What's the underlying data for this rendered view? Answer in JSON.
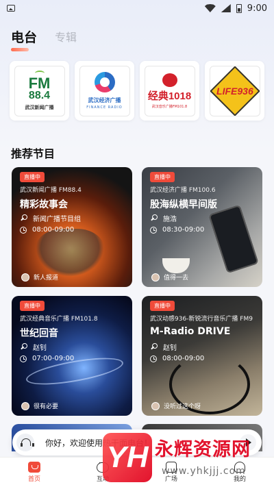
{
  "status_bar": {
    "time": "9:00"
  },
  "tabs": [
    {
      "label": "电台",
      "active": true
    },
    {
      "label": "专辑",
      "active": false
    }
  ],
  "stations": [
    {
      "icon": "fm884-logo",
      "line1": "FM",
      "line2": "88.4",
      "caption": "武汉新闻广播"
    },
    {
      "icon": "finance-radio-logo",
      "caption": "武汉经济广播",
      "caption_en": "FINANCE RADIO"
    },
    {
      "icon": "jingdian1018-logo",
      "line1": "经典1018",
      "caption": "武汉音乐广播FM101.8"
    },
    {
      "icon": "dynamic936-logo",
      "line1": "LIFE936"
    }
  ],
  "section": {
    "title": "推荐节目"
  },
  "programs": [
    {
      "badge": "直播中",
      "station": "武汉新闻广播 FM88.4",
      "title": "精彩故事会",
      "host": "新闻广播节目组",
      "time": "08:00-09:00",
      "foot": "新人报道"
    },
    {
      "badge": "直播中",
      "station": "武汉经济广播 FM100.6",
      "title": "股海纵横早间版",
      "host": "施浩",
      "time": "08:30-09:00",
      "foot": "值得一去"
    },
    {
      "badge": "直播中",
      "station": "武汉经典音乐广播 FM101.8",
      "title": "世纪回音",
      "host": "赵钊",
      "time": "07:00-09:00",
      "foot": "很有必要"
    },
    {
      "badge": "直播中",
      "station": "武汉动感936-新锐流行音乐广播 FM9",
      "title": "M-Radio DRIVE",
      "host": "赵钊",
      "time": "08:00-09:00",
      "foot": "没听过这个呀"
    }
  ],
  "player": {
    "text": "你好，欢迎使用热干面电台！"
  },
  "nav": [
    {
      "label": "首页",
      "active": true
    },
    {
      "label": "互动",
      "active": false
    },
    {
      "label": "广场",
      "active": false
    },
    {
      "label": "我的",
      "active": false
    }
  ],
  "watermark": {
    "logo": "YH",
    "text": "永辉资源网",
    "url": "www.yhkjjj.com"
  },
  "colors": {
    "accent": "#f04b3a",
    "badge": "#f04b3a"
  }
}
